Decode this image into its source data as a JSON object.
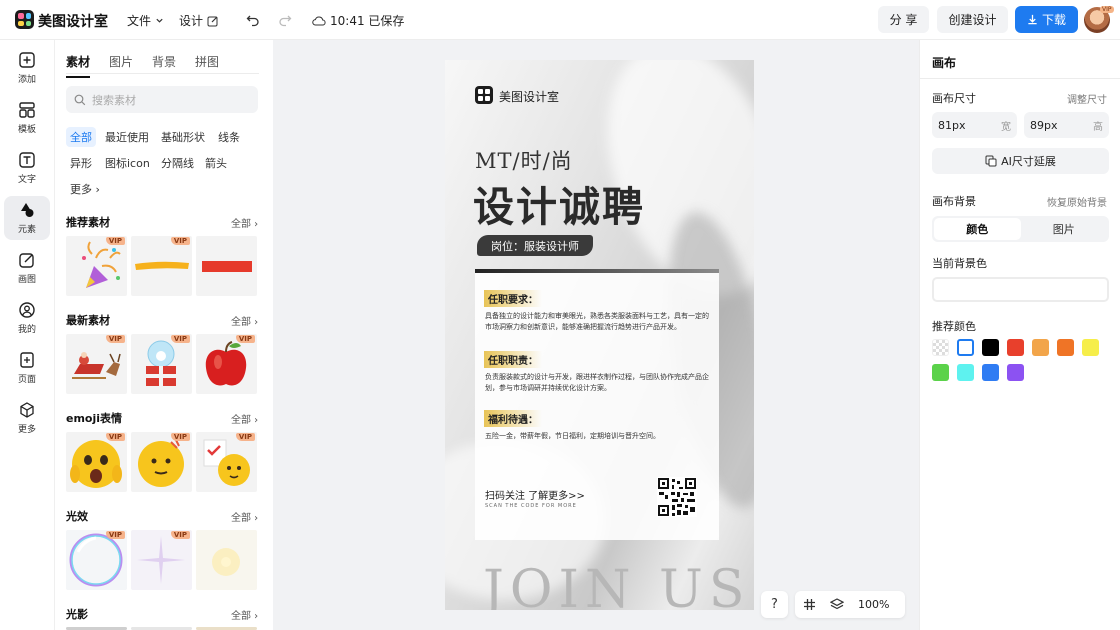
{
  "app": {
    "name": "美图设计室"
  },
  "topbar": {
    "menu_file": "文件",
    "menu_design": "设计",
    "save_status": "10:41 已保存",
    "share": "分 享",
    "create_design": "创建设计",
    "download": "下载",
    "avatar_badge": "VIP"
  },
  "leftnav": {
    "items": [
      {
        "label": "添加",
        "icon": "plus-square-icon"
      },
      {
        "label": "模板",
        "icon": "template-icon"
      },
      {
        "label": "文字",
        "icon": "text-icon"
      },
      {
        "label": "元素",
        "icon": "shapes-icon"
      },
      {
        "label": "画图",
        "icon": "draw-icon"
      },
      {
        "label": "我的",
        "icon": "user-icon"
      },
      {
        "label": "页面",
        "icon": "page-add-icon"
      },
      {
        "label": "更多",
        "icon": "cube-icon"
      }
    ],
    "active_index": 3
  },
  "panel": {
    "tabs": [
      "素材",
      "图片",
      "背景",
      "拼图"
    ],
    "active_tab": 0,
    "search_placeholder": "搜索素材",
    "chips": [
      "全部",
      "最近使用",
      "基础形状",
      "线条",
      "异形",
      "图标icon",
      "分隔线",
      "箭头",
      "更多"
    ],
    "sections": [
      {
        "title": "推荐素材",
        "more": "全部"
      },
      {
        "title": "最新素材",
        "more": "全部"
      },
      {
        "title": "emoji表情",
        "more": "全部"
      },
      {
        "title": "光效",
        "more": "全部"
      },
      {
        "title": "光影",
        "more": "全部"
      }
    ],
    "vip_label": "VIP"
  },
  "poster": {
    "brand": "美图设计室",
    "subtitle": "MT/时/尚",
    "title": "设计诚聘",
    "position": "岗位：服装设计师",
    "req_title": "任职要求：",
    "req_text": "具备独立的设计能力和审美眼光，熟悉各类服装面料与工艺，具有一定的市场洞察力和创新意识，能够准确把握流行趋势进行产品开发。",
    "duty_title": "任职职责：",
    "duty_text": "负责服装款式的设计与开发，跟进样衣制作过程，与团队协作完成产品企划，参与市场调研并持续优化设计方案。",
    "benefit_title": "福利待遇：",
    "benefit_text": "五险一金，带薪年假，节日福利，定期培训与晋升空间。",
    "scan_text": "扫码关注 了解更多>>",
    "scan_sub": "SCAN THE CODE FOR MORE",
    "join": "JOIN US"
  },
  "bottom_tools": {
    "help": "?",
    "zoom": "100%"
  },
  "rightpanel": {
    "title": "画布",
    "canvas_size_label": "画布尺寸",
    "adjust_size": "调整尺寸",
    "width_value": "81px",
    "width_unit": "宽",
    "height_value": "89px",
    "height_unit": "高",
    "ai_extend": "AI尺寸延展",
    "bg_label": "画布背景",
    "restore_bg": "恢复原始背景",
    "seg_color": "颜色",
    "seg_image": "图片",
    "current_bg_label": "当前背景色",
    "recommended_label": "推荐颜色",
    "swatches": [
      "transparent",
      "#ffffff",
      "#000000",
      "#e8402c",
      "#f2a54a",
      "#ef7426",
      "#f6ee4a",
      "#5bd24a",
      "#5ef2ef",
      "#2f7cf3",
      "#8c52f2"
    ]
  },
  "colors": {
    "accent": "#1e7bf0",
    "vip": "#f6b38b"
  }
}
